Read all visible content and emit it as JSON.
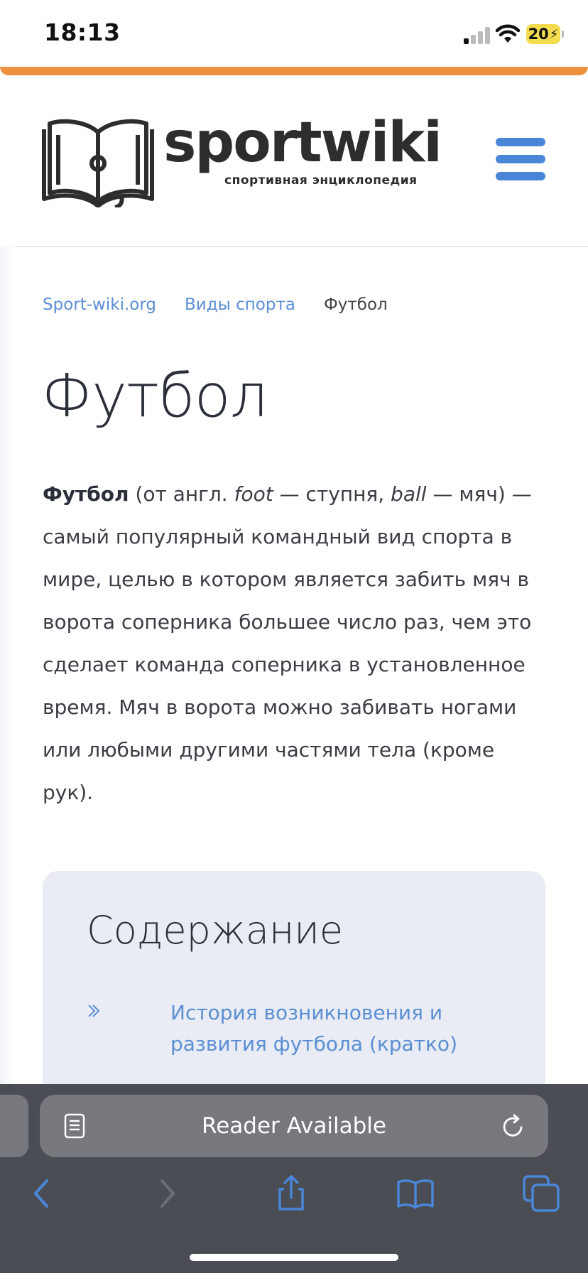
{
  "status": {
    "time": "18:13",
    "battery": "20"
  },
  "logo": {
    "word": "sportwiki",
    "tagline": "спортивная энциклопедия"
  },
  "breadcrumb": [
    {
      "label": "Sport-wiki.org"
    },
    {
      "label": "Виды спорта"
    }
  ],
  "breadcrumb_current": "Футбол",
  "article": {
    "title": "Футбол",
    "intro_bold": "Футбол",
    "intro_p1": " (от англ. ",
    "intro_i1": "foot",
    "intro_p2": " — ступня, ",
    "intro_i2": "ball",
    "intro_p3": " — мяч) — самый популярный командный вид спорта в мире, целью в котором является забить мяч в ворота соперника большее число раз, чем это сделает команда соперника в установленное время. Мяч в ворота можно забивать ногами или любыми другими частями тела (кроме рук)."
  },
  "toc": {
    "title": "Содержание",
    "items": [
      {
        "label": "История возникновения и развития футбола (кратко)"
      }
    ]
  },
  "browser": {
    "url_text": "Reader Available"
  },
  "colors": {
    "accent": "#4a86d8",
    "orange": "#ee9240",
    "link": "#5b8fd3"
  },
  "icons": [
    "signal-icon",
    "wifi-icon",
    "battery-icon",
    "hamburger-menu-icon",
    "chevron-right-icon",
    "reader-icon",
    "reload-icon",
    "back-icon",
    "forward-icon",
    "share-icon",
    "bookmarks-icon",
    "tabs-icon"
  ]
}
